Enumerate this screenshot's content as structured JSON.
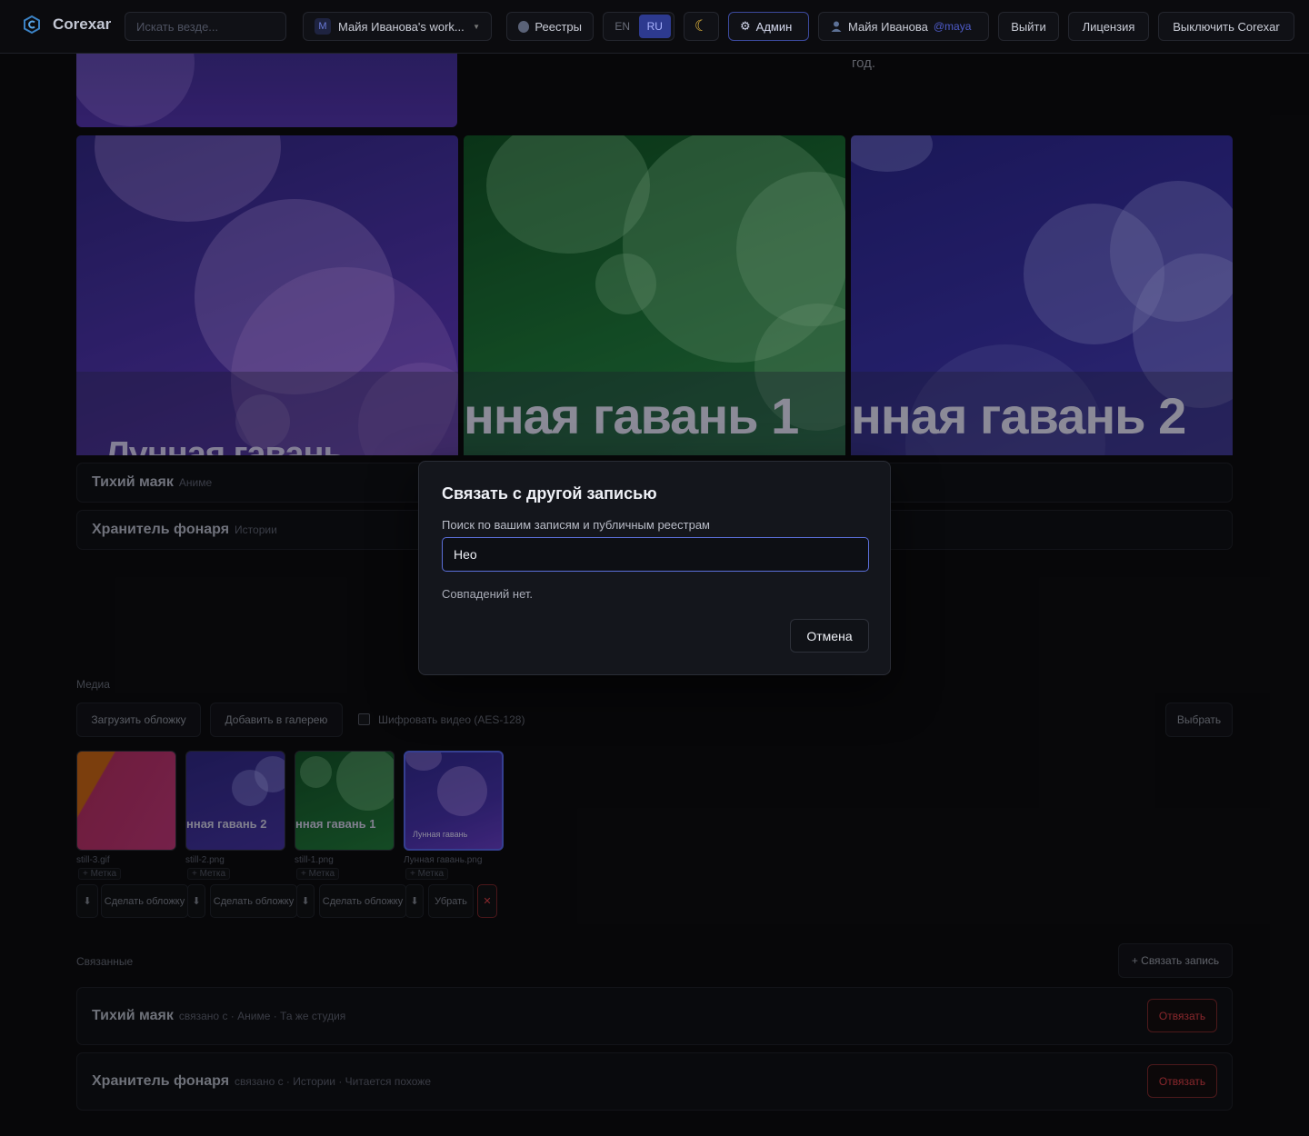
{
  "topbar": {
    "app_name": "Corexar",
    "search_placeholder": "Искать везде...",
    "workspace_badge": "M",
    "workspace_name": "Майя Иванова's work...",
    "registries": "Реестры",
    "lang_en": "EN",
    "lang_ru": "RU",
    "theme_icon": "☾",
    "admin": "Админ",
    "admin_icon": "⚙",
    "user_name": "Майя Иванова",
    "user_handle": "@maya",
    "logout": "Выйти",
    "license": "Лицензия",
    "disable": "Выключить Corexar"
  },
  "background": {
    "description_tail": "год.",
    "covers": [
      {
        "title": "Лунная гавань"
      },
      {
        "title": "нная гавань 1"
      },
      {
        "title": "нная гавань 2"
      }
    ],
    "linked_top": [
      {
        "name": "Тихий маяк",
        "tag": "Аниме"
      },
      {
        "name": "Хранитель фонаря",
        "tag": "Истории"
      }
    ]
  },
  "media": {
    "section_label": "Медиа",
    "upload_cover": "Загрузить обложку",
    "add_gallery": "Добавить в галерею",
    "encrypt_label": "Шифровать видео (AES-128)",
    "choose": "Выбрать",
    "items": [
      {
        "file": "still-3.gif",
        "tag": "+ Метка",
        "thumb_title": ""
      },
      {
        "file": "still-2.png",
        "tag": "+ Метка",
        "thumb_title": "нная гавань 2"
      },
      {
        "file": "still-1.png",
        "tag": "+ Метка",
        "thumb_title": "нная гавань 1"
      },
      {
        "file": "Лунная гавань.png",
        "tag": "+ Метка",
        "thumb_title": "Лунная гавань"
      }
    ],
    "make_cover": "Сделать обложку",
    "download_icon": "⬇",
    "remove": "Убрать",
    "delete_icon": "✕"
  },
  "related": {
    "section_label": "Связанные",
    "link_button": "+ Связать запись",
    "items": [
      {
        "name": "Тихий маяк",
        "meta": "связано с · Аниме · Та же студия",
        "unlink": "Отвязать"
      },
      {
        "name": "Хранитель фонаря",
        "meta": "связано с · Истории · Читается похоже",
        "unlink": "Отвязать"
      }
    ]
  },
  "modal": {
    "title": "Связать с другой записью",
    "search_label": "Поиск по вашим записям и публичным реестрам",
    "search_value": "Нео",
    "no_matches": "Совпадений нет.",
    "cancel": "Отмена"
  }
}
